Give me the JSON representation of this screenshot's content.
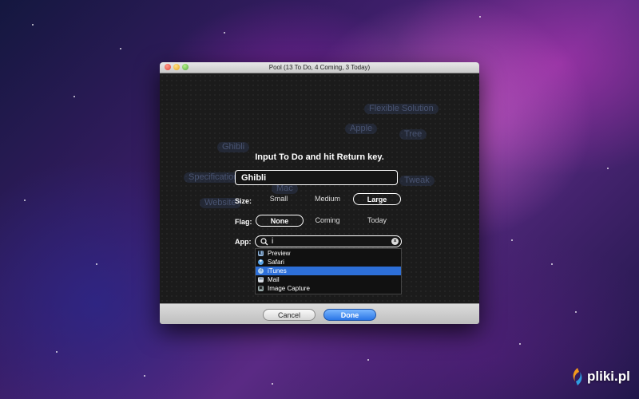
{
  "window": {
    "title": "Pool (13 To Do, 4 Coming, 3 Today)"
  },
  "background_todos": [
    "Flexible Solution",
    "Apple",
    "Tree",
    "Ghibli",
    "Specification",
    "Mac",
    "Tweak",
    "Website"
  ],
  "dialog": {
    "prompt": "Input To Do and hit Return key.",
    "todo_value": "Ghibli",
    "size": {
      "label": "Size:",
      "options": [
        "Small",
        "Medium",
        "Large"
      ],
      "selected": "Large"
    },
    "flag": {
      "label": "Flag:",
      "options": [
        "None",
        "Coming",
        "Today"
      ],
      "selected": "None"
    },
    "app": {
      "label": "App:",
      "search_value": "i",
      "suggestions": [
        {
          "label": "Preview",
          "icon": "preview-icon"
        },
        {
          "label": "Safari",
          "icon": "safari-icon"
        },
        {
          "label": "iTunes",
          "icon": "itunes-icon",
          "selected": true
        },
        {
          "label": "Mail",
          "icon": "mail-icon"
        },
        {
          "label": "Image Capture",
          "icon": "image-capture-icon"
        }
      ]
    }
  },
  "buttons": {
    "cancel": "Cancel",
    "done": "Done"
  },
  "colors": {
    "accent": "#2a76e6",
    "selection": "#2d6fd8"
  },
  "watermark": {
    "text": "pliki.pl"
  }
}
